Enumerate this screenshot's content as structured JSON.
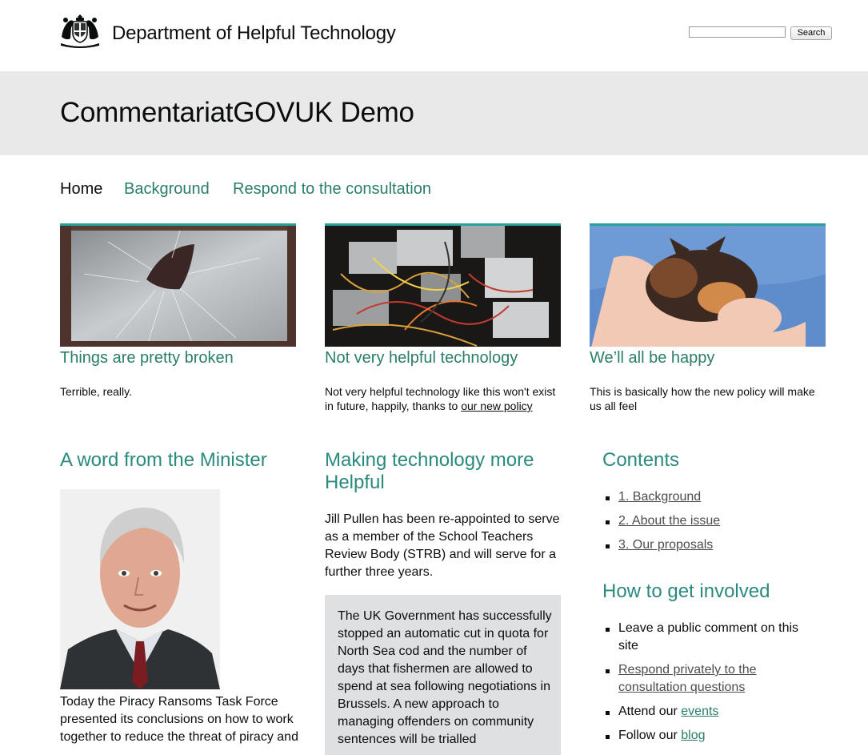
{
  "header": {
    "department": "Department of Helpful Technology",
    "search_placeholder": "",
    "search_button": "Search"
  },
  "banner": {
    "title": "CommentariatGOVUK Demo"
  },
  "nav": {
    "items": [
      {
        "label": "Home",
        "active": true
      },
      {
        "label": "Background",
        "active": false
      },
      {
        "label": "Respond to the consultation",
        "active": false
      }
    ]
  },
  "cards": [
    {
      "title": "Things are pretty broken",
      "text": "Terrible, really.",
      "image": "broken-window-photo"
    },
    {
      "title": "Not very helpful technology",
      "text_before": "Not very helpful technology like this won't exist in future, happily, thanks to ",
      "link": "our new policy",
      "image": "tangled-power-supplies-photo"
    },
    {
      "title": "We’ll all be happy",
      "text": "This is basically how the new policy will make us all feel",
      "image": "sleeping-kitten-photo"
    }
  ],
  "minister": {
    "heading": "A word from the Minister",
    "text": "Today the Piracy Ransoms Task Force presented its conclusions on how to work together to reduce the threat of piracy and"
  },
  "making": {
    "heading": "Making technology more Helpful",
    "text": "Jill Pullen has been re-appointed to serve as a member of the School Teachers Review Body (STRB) and will serve for a further three years.",
    "callout": "The UK Government has successfully stopped an automatic cut in quota for North Sea cod and the number of days that fishermen are allowed to spend at sea following negotiations in Brussels. A new approach to managing offenders on community sentences will be trialled"
  },
  "contents": {
    "heading": "Contents",
    "items": [
      "1. Background",
      "2. About the issue",
      "3. Our proposals"
    ]
  },
  "involved": {
    "heading": "How to get involved",
    "item1": "Leave a public comment on this site",
    "item2": "Respond privately to the consultation questions",
    "item3_text": "Attend our ",
    "item3_link": "events",
    "item4_text": "Follow our ",
    "item4_link": "blog"
  },
  "colors": {
    "accent": "#2a7d69",
    "banner": "#e9e9e9",
    "callout": "#dee0e2",
    "card_rule": "#28a197"
  }
}
